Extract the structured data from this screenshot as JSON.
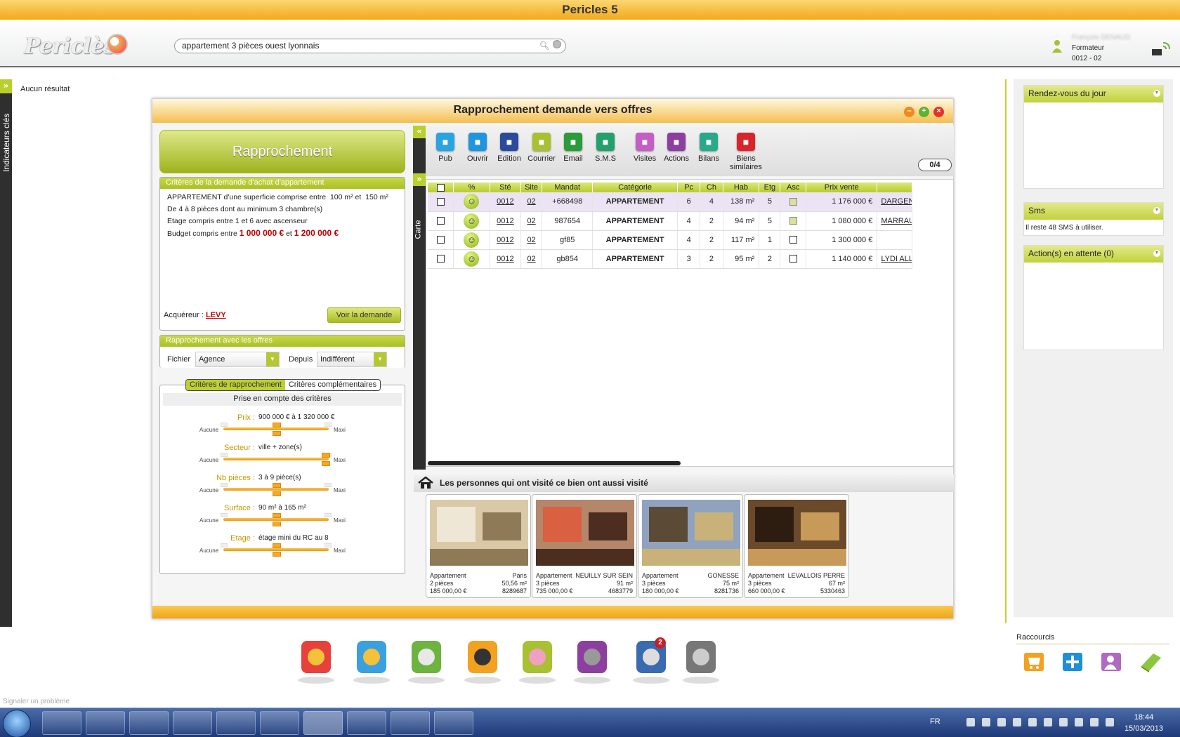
{
  "app": {
    "title": "Pericles 5"
  },
  "header": {
    "logo_text": "Periclès",
    "search_value": "appartement 3 pièces ouest lyonnais",
    "user_name": "François DENAUD",
    "user_role": "Formateur",
    "user_agency": "0012 - 02"
  },
  "left_tab": {
    "label": "Indicateurs clés"
  },
  "no_result": "Aucun résultat",
  "report_problem": "Signaler un problème",
  "dialog": {
    "title": "Rapprochement demande vers offres",
    "big_button": "Rapprochement",
    "criteria_header": "Critères de la demande d'achat d'appartement",
    "criteria": {
      "line1_a": "APPARTEMENT d'une superficie comprise entre",
      "line1_b": "100 m² et",
      "line1_c": "150 m²",
      "line2": "De  4  à  8 pièces dont au minimum 3 chambre(s)",
      "line3": "Etage compris entre 1 et 6 avec ascenseur",
      "line4_a": "Budget compris entre",
      "line4_b": "1 000 000 €",
      "line4_c": "et",
      "line4_d": "1 200 000 €"
    },
    "acquereur_label": "Acquéreur :",
    "acquereur_name": "LEVY",
    "voir_button": "Voir la demande",
    "offers_header": "Rapprochement avec les offres",
    "fichier_label": "Fichier",
    "fichier_value": "Agence",
    "depuis_label": "Depuis",
    "depuis_value": "Indifférent",
    "tab_criteres": "Critères de rapprochement",
    "tab_complementaires": "Critères complémentaires",
    "prise_en_compte": "Prise en compte des critères",
    "slider_min": "Aucune",
    "slider_max": "Maxi",
    "sliders": [
      {
        "label": "Prix :",
        "value": "900 000 € à 1 320 000 €",
        "level": 0.5
      },
      {
        "label": "Secteur :",
        "value": "ville + zone(s)",
        "level": 1.0
      },
      {
        "label": "Nb pièces :",
        "value": "3 à 9 pièce(s)",
        "level": 0.5
      },
      {
        "label": "Surface :",
        "value": "90 m² à   165 m²",
        "level": 0.5
      },
      {
        "label": "Etage :",
        "value": "étage mini du RC au 8",
        "level": 0.5
      }
    ],
    "carte_label": "Carte",
    "toolbar": [
      {
        "label": "Pub",
        "icon": "pub-icon",
        "color": "#2aa4e0"
      },
      {
        "label": "Ouvrir",
        "icon": "pencil-icon",
        "color": "#1f95e0"
      },
      {
        "label": "Edition",
        "icon": "printer-icon",
        "color": "#2b4a9c"
      },
      {
        "label": "Courrier",
        "icon": "letter-icon",
        "color": "#a8c032"
      },
      {
        "label": "Email",
        "icon": "envelope-icon",
        "color": "#2b9b3b"
      },
      {
        "label": "S.M.S",
        "icon": "phone-icon",
        "color": "#23a06c"
      },
      {
        "label": "Visites",
        "icon": "people-icon",
        "color": "#c45ec4"
      },
      {
        "label": "Actions",
        "icon": "hand-icon",
        "color": "#8c3f9e"
      },
      {
        "label": "Bilans",
        "icon": "magnifier-icon",
        "color": "#2aa88a"
      },
      {
        "label": "Biens similaires",
        "icon": "house-icon",
        "color": "#d7262b"
      }
    ],
    "selection_count": "0/4",
    "columns": [
      "",
      "%",
      "Sté",
      "Site",
      "Mandat",
      "Catégorie",
      "Pc",
      "Ch",
      "Hab",
      "Etg",
      "Asc",
      "Prix vente",
      ""
    ],
    "rows": [
      {
        "ste": "0012",
        "site": "02",
        "mandat": "+668498",
        "categorie": "APPARTEMENT",
        "pc": "6",
        "ch": "4",
        "hab": "138 m²",
        "etg": "5",
        "asc": true,
        "prix": "1 176 000 €",
        "owner": "DARGENT"
      },
      {
        "ste": "0012",
        "site": "02",
        "mandat": "987654",
        "categorie": "APPARTEMENT",
        "pc": "4",
        "ch": "2",
        "hab": "94 m²",
        "etg": "5",
        "asc": true,
        "prix": "1 080 000 €",
        "owner": "MARRAU"
      },
      {
        "ste": "0012",
        "site": "02",
        "mandat": "gf85",
        "categorie": "APPARTEMENT",
        "pc": "4",
        "ch": "2",
        "hab": "117 m²",
        "etg": "1",
        "asc": false,
        "prix": "1 300 000 €",
        "owner": ""
      },
      {
        "ste": "0012",
        "site": "02",
        "mandat": "gb854",
        "categorie": "APPARTEMENT",
        "pc": "3",
        "ch": "2",
        "hab": "95 m²",
        "etg": "2",
        "asc": false,
        "prix": "1 140 000 €",
        "owner": "LYDI ALL"
      }
    ],
    "visited_title": "Les personnes qui ont visité ce bien ont aussi visité",
    "visited": [
      {
        "type": "Appartement",
        "city": "Paris",
        "rooms": "2 pièces",
        "area": "50,56 m²",
        "price": "185 000,00 €",
        "ref": "8289687"
      },
      {
        "type": "Appartement",
        "city": "NEUILLY SUR SEIN",
        "rooms": "3 pièces",
        "area": "91 m²",
        "price": "735 000,00 €",
        "ref": "4683779"
      },
      {
        "type": "Appartement",
        "city": "GONESSE",
        "rooms": "3 pièces",
        "area": "75 m²",
        "price": "180 000,00 €",
        "ref": "8281736"
      },
      {
        "type": "Appartement",
        "city": "LEVALLOIS PERRE",
        "rooms": "3 pièces",
        "area": "67 m²",
        "price": "660 000,00 €",
        "ref": "5330463"
      }
    ]
  },
  "right_panel": {
    "rdv_title": "Rendez-vous du jour",
    "sms_title": "Sms",
    "sms_text": "Il reste 48 SMS à utiliser.",
    "actions_title": "Action(s) en attente (0)",
    "raccourcis": "Raccourcis"
  },
  "dock_badge": "2",
  "taskbar": {
    "lang": "FR",
    "time": "18:44",
    "date": "15/03/2013"
  }
}
